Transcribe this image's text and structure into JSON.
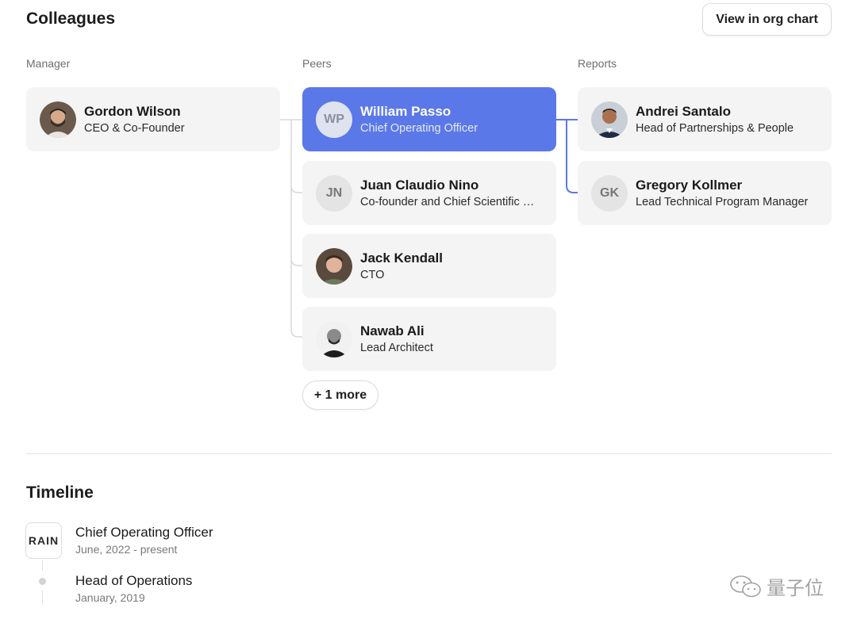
{
  "colleagues": {
    "title": "Colleagues",
    "org_chart_button": "View in org chart",
    "columns": {
      "manager": "Manager",
      "peers": "Peers",
      "reports": "Reports"
    },
    "manager": {
      "name": "Gordon Wilson",
      "role": "CEO & Co-Founder",
      "avatar": "photo"
    },
    "peers": [
      {
        "name": "William Passo",
        "role": "Chief Operating Officer",
        "initials": "WP",
        "selected": true
      },
      {
        "name": "Juan Claudio Nino",
        "role": "Co-founder and Chief Scientific …",
        "initials": "JN"
      },
      {
        "name": "Jack Kendall",
        "role": "CTO",
        "avatar": "photo"
      },
      {
        "name": "Nawab Ali",
        "role": "Lead Architect",
        "avatar": "photo"
      }
    ],
    "more_button": "+ 1 more",
    "reports": [
      {
        "name": "Andrei Santalo",
        "role": "Head of Partnerships & People",
        "avatar": "photo"
      },
      {
        "name": "Gregory Kollmer",
        "role": "Lead Technical Program Manager",
        "initials": "GK"
      }
    ]
  },
  "timeline": {
    "title": "Timeline",
    "company_logo_text": "RAIN",
    "items": [
      {
        "title": "Chief Operating Officer",
        "date": "June, 2022 - present"
      },
      {
        "title": "Head of Operations",
        "date": "January, 2019"
      }
    ]
  },
  "watermark": {
    "text": "量子位",
    "icon": "wechat-icon"
  },
  "colors": {
    "accent": "#5b78e8",
    "card_bg": "#f4f4f4",
    "connector": "#d9d9d9"
  }
}
